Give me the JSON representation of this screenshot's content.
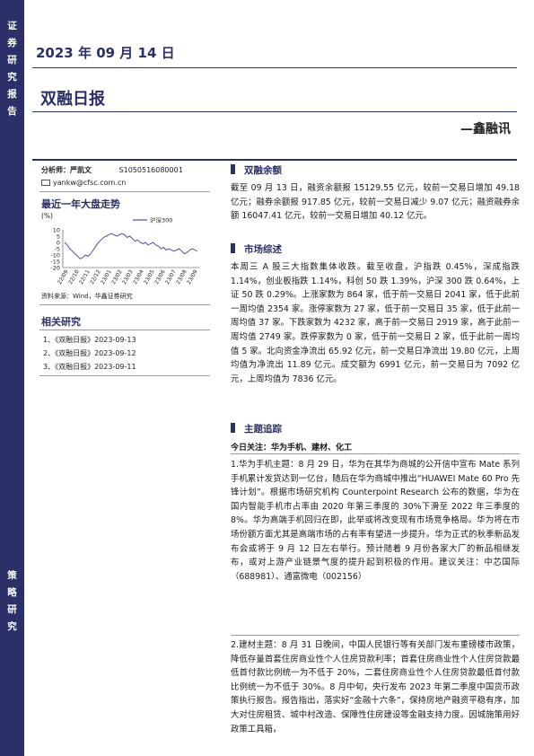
{
  "sidebar": {
    "top_text": [
      "证",
      "券",
      "研",
      "究",
      "报",
      "告"
    ],
    "bottom_text": [
      "策",
      "略",
      "研",
      "究"
    ]
  },
  "header": {
    "date": "2023 年 09 月 14 日",
    "title": "双融日报",
    "brand": "—鑫融讯"
  },
  "analyst": {
    "label": "分析师：严凯文",
    "code": "S1050516080001",
    "email": "yankw@cfsc.com.cn"
  },
  "chart": {
    "title": "最近一年大盘走势",
    "unit": "(%)",
    "legend": "沪深300",
    "source": "资料来源：Wind，华鑫证券研究"
  },
  "chart_data": {
    "type": "line",
    "series": [
      {
        "name": "沪深300",
        "values": [
          0,
          -2,
          -5,
          -7,
          -9,
          -11,
          -13,
          -12,
          -10,
          -11,
          -9,
          -6,
          -3,
          0,
          2,
          4,
          5,
          6,
          7,
          6,
          5,
          6,
          7,
          6,
          4,
          5,
          3,
          1,
          2,
          0,
          -1,
          0,
          -2,
          -1,
          0,
          -2,
          -3,
          -5,
          -4,
          -6,
          -5,
          -6,
          -7,
          -6,
          -5,
          -7,
          -9,
          -8,
          -6,
          -5,
          -6,
          -7
        ]
      }
    ],
    "x_ticks": [
      "22/09",
      "22/10",
      "22/11",
      "22/12",
      "23/01",
      "23/02",
      "23/03",
      "23/04",
      "23/05",
      "23/06",
      "23/07",
      "23/08",
      "23/09"
    ],
    "y_ticks": [
      10,
      5,
      0,
      -5,
      -10,
      -15,
      -20
    ],
    "ylim": [
      -20,
      10
    ],
    "line_color": "#5b4a9a"
  },
  "related": {
    "title": "相关研究",
    "items": [
      "1、《双融日报》2023-09-13",
      "2、《双融日报》2023-09-12",
      "3、《双融日报》2023-09-11"
    ]
  },
  "sections": {
    "balance_title": "双融余额",
    "balance_text": "截至 09 月 13 日，融资余额报 15129.55 亿元，较前一交易日增加 49.18 亿元；融券余额报 917.85 亿元，较前一交易日减少 9.07 亿元；融资融券余额 16047.41 亿元，较前一交易日增加 40.12 亿元。",
    "market_title": "市场综述",
    "market_text": "本周三 A 股三大指数集体收跌。截至收盘，沪指跌 0.45%，深成指跌 1.14%，创业板指跌 1.14%，科创 50 跌 1.39%，沪深 300 跌 0.64%，上证 50 跌 0.29%。上涨家数为 864 家，低于前一交易日 2041 家，低于此前一周均值 2354 家。涨停家数为 27 家，低于前一交易日 35 家，低于此前一周均值 37 家。下跌家数为 4232 家，高于前一交易日 2919 家，高于此前一周均值 2749 家。跌停家数为 0 家，低于前一交易日 2 家，低于此前一周均值 5 家。北向资金净流出 65.92 亿元，前一交易日净流出 19.80 亿元，上周均值为净流出 11.89 亿元。成交额为 6991 亿元，前一交易日为 7092 亿元，上周均值为 7836 亿元。",
    "theme_title": "主题追踪",
    "today_focus": "今日关注：华为手机、建材、化工",
    "item1": "1.华为手机主题：8 月 29 日，华为在其华为商城的公开信中宣布 Mate 系列手机累计发货达到一亿台，随后在华为商城中推出“HUAWEI Mate 60 Pro 先锋计划”。根据市场研究机构 Counterpoint Research 公布的数据，华为在国内智能手机市占率由 2020 年第三季度的 30%下滑至 2022 年三季度的 8%。华为高端手机回归在即，此举或将改变现有市场竞争格局。华为将在市场份额方面尤其是高端市场的占有率有望进一步提升。华为正式的秋季新品发布会或将于 9 月 12 日左右举行。预计随着 9 月份各家大厂的新品相继发布，或对上游产业链景气度的提升起到积极的作用。建议关注：中芯国际（688981）、通富微电（002156）",
    "item2": "2.建材主题：8 月 31 日晚间，中国人民银行等有关部门发布重磅楼市政策，降低存量首套住房商业性个人住房贷款利率；首套住房商业性个人住房贷款最低首付款比例统一为不低于 20%，二套住房商业性个人住房贷款最低首付款比例统一为不低于 30%。8 月中旬，央行发布 2023 年第二季度中国货币政策执行报告。报告指出，落实好“金融十六条”，保持房地产融资平稳有序，加大对住房租赁、城中村改造、保障性住房建设等金融支持力度。因城施策用好政策工具箱，"
  }
}
